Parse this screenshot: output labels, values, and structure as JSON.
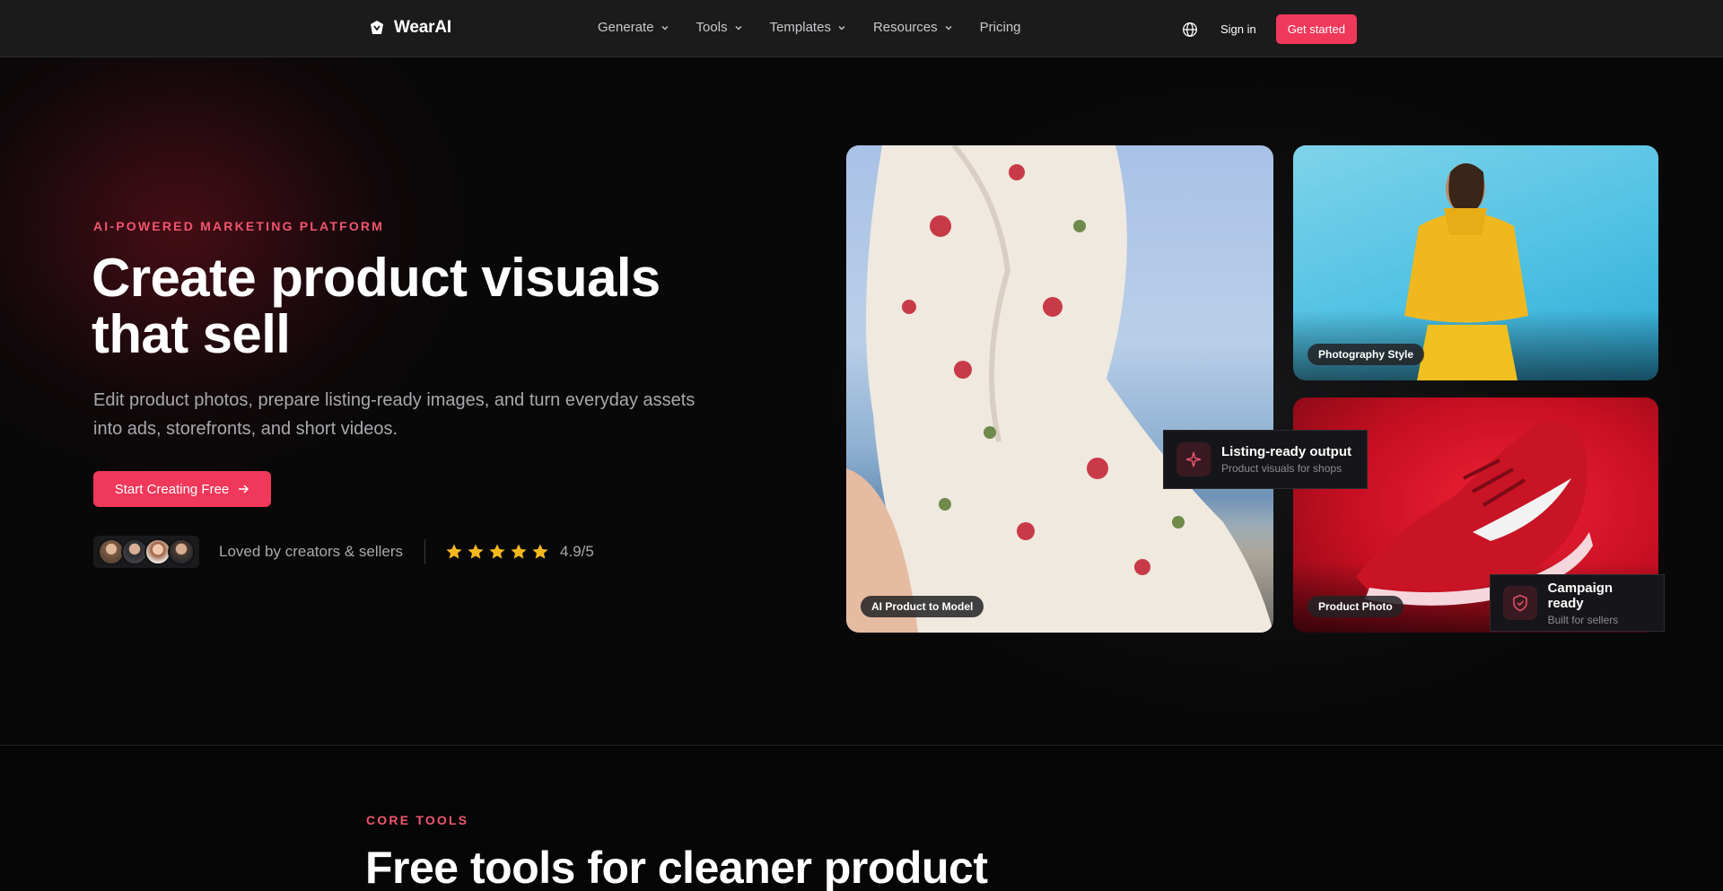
{
  "brand": {
    "name": "WearAI"
  },
  "nav": {
    "items": [
      {
        "label": "Generate",
        "dropdown": true
      },
      {
        "label": "Tools",
        "dropdown": true
      },
      {
        "label": "Templates",
        "dropdown": true
      },
      {
        "label": "Resources",
        "dropdown": true
      },
      {
        "label": "Pricing",
        "dropdown": false
      }
    ],
    "language_icon": "globe-icon",
    "signin_label": "Sign in",
    "cta_label": "Get started"
  },
  "hero": {
    "eyebrow": "AI-POWERED MARKETING PLATFORM",
    "headline": "Create product visuals that sell",
    "subtext": "Edit product photos, prepare listing-ready images, and turn everyday assets into ads, storefronts, and short videos.",
    "cta_label": "Start Creating Free",
    "social_text": "Loved by creators & sellers",
    "rating_text": "4.9/5",
    "stars": 5
  },
  "showcase": {
    "card_main_label": "AI Product to Model",
    "card_top_label": "Photography Style",
    "card_bottom_label": "Product Photo",
    "float1": {
      "title": "Listing-ready output",
      "subtitle": "Product visuals for shops"
    },
    "float2": {
      "title": "Campaign ready",
      "subtitle": "Built for sellers"
    }
  },
  "core": {
    "eyebrow": "CORE TOOLS",
    "title": "Free tools for cleaner product"
  },
  "colors": {
    "accent": "#f0385a",
    "eyebrow": "#f0566f",
    "star": "#f5b91e",
    "bg": "#060606"
  }
}
